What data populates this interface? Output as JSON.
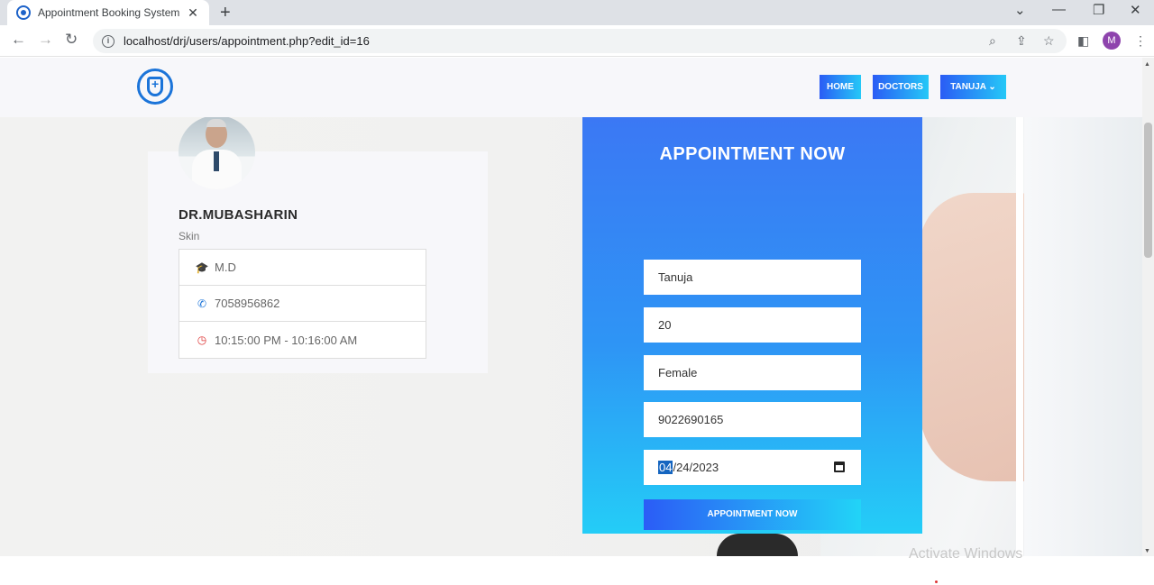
{
  "browser": {
    "tab_title": "Appointment Booking System",
    "tab_close": "✕",
    "new_tab": "+",
    "url": "localhost/drj/users/appointment.php?edit_id=16",
    "profile_initial": "M"
  },
  "navbar": {
    "home": "HOME",
    "doctors": "DOCTORS",
    "user_menu": "TANUJA ⌄"
  },
  "doctor": {
    "name": "DR.MUBASHARIN",
    "specialty": "Skin",
    "degree": "M.D",
    "phone": "7058956862",
    "timing": "10:15:00 PM - 10:16:00 AM"
  },
  "form": {
    "title": "APPOINTMENT NOW",
    "name": "Tanuja",
    "age": "20",
    "gender": "Female",
    "phone": "9022690165",
    "date_month": "04",
    "date_rest": "/24/2023",
    "submit": "APPOINTMENT NOW"
  },
  "watermark": "Activate Windows",
  "icons": {
    "degree": "graduation-cap-icon",
    "phone": "phone-icon",
    "clock": "clock-icon"
  },
  "colors": {
    "accent_start": "#2a5cf5",
    "accent_end": "#25c8f7"
  }
}
